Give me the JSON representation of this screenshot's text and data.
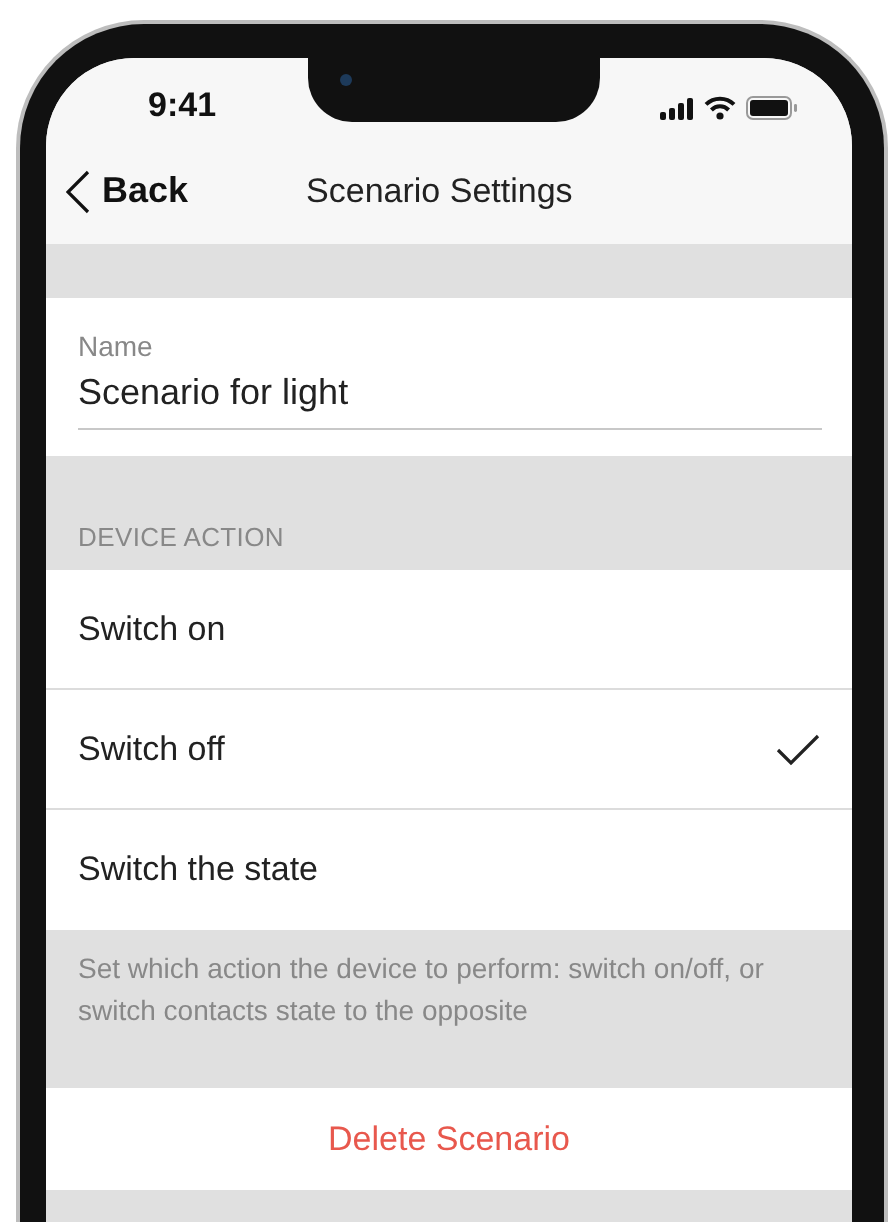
{
  "status_bar": {
    "time": "9:41"
  },
  "nav": {
    "back_label": "Back",
    "title": "Scenario Settings"
  },
  "name_field": {
    "label": "Name",
    "value": "Scenario for light"
  },
  "device_action": {
    "header": "DEVICE ACTION",
    "options": [
      {
        "label": "Switch on",
        "selected": false
      },
      {
        "label": "Switch off",
        "selected": true
      },
      {
        "label": "Switch the state",
        "selected": false
      }
    ],
    "footnote": "Set which action the device to perform: switch on/off, or switch contacts state to the opposite"
  },
  "delete_button": "Delete Scenario"
}
